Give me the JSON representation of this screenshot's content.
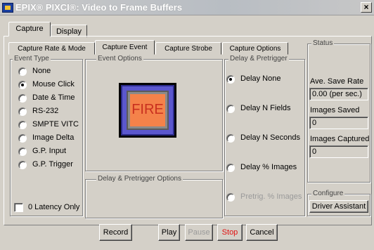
{
  "window": {
    "title": "EPIX® PIXCI®: Video to Frame Buffers",
    "close_glyph": "×"
  },
  "main_tabs": [
    {
      "label": "Capture"
    },
    {
      "label": "Display"
    }
  ],
  "sub_tabs": [
    {
      "label": "Capture Rate & Mode"
    },
    {
      "label": "Capture Event"
    },
    {
      "label": "Capture Strobe"
    },
    {
      "label": "Capture Options"
    }
  ],
  "event_type": {
    "legend": "Event Type",
    "options": [
      {
        "label": "None"
      },
      {
        "label": "Mouse Click"
      },
      {
        "label": "Date & Time"
      },
      {
        "label": "RS-232"
      },
      {
        "label": "SMPTE VITC"
      },
      {
        "label": "Image Delta"
      },
      {
        "label": "G.P. Input"
      },
      {
        "label": "G.P. Trigger"
      }
    ],
    "selected": "Mouse Click"
  },
  "latency": {
    "label": "0 Latency Only"
  },
  "event_options": {
    "legend": "Event Options",
    "fire_label": "FIRE"
  },
  "delay_pretrigger_options": {
    "legend": "Delay & Pretrigger Options"
  },
  "delay_pretrigger": {
    "legend": "Delay & Pretrigger",
    "options": [
      {
        "label": "Delay None"
      },
      {
        "label": "Delay N Fields"
      },
      {
        "label": "Delay N Seconds"
      },
      {
        "label": "Delay % Images"
      },
      {
        "label": "Pretrig. % Images"
      }
    ],
    "selected": "Delay None"
  },
  "status": {
    "legend": "Status",
    "ave_save_rate_label": "Ave. Save Rate",
    "ave_save_rate_value": "0.00 (per sec.)",
    "images_saved_label": "Images Saved",
    "images_saved_value": "0",
    "images_captured_label": "Images Captured",
    "images_captured_value": "0"
  },
  "configure": {
    "legend": "Configure",
    "driver_button": "Driver Assistant"
  },
  "buttons": {
    "record": "Record",
    "play": "Play",
    "pause": "Pause",
    "stop": "Stop",
    "cancel": "Cancel"
  },
  "colors": {
    "fire_frame": "#5b57ce",
    "fire_face": "#f4824a",
    "fire_text": "#c9301f",
    "stop_text": "#e01010",
    "disabled_text": "#9a9a9a"
  }
}
